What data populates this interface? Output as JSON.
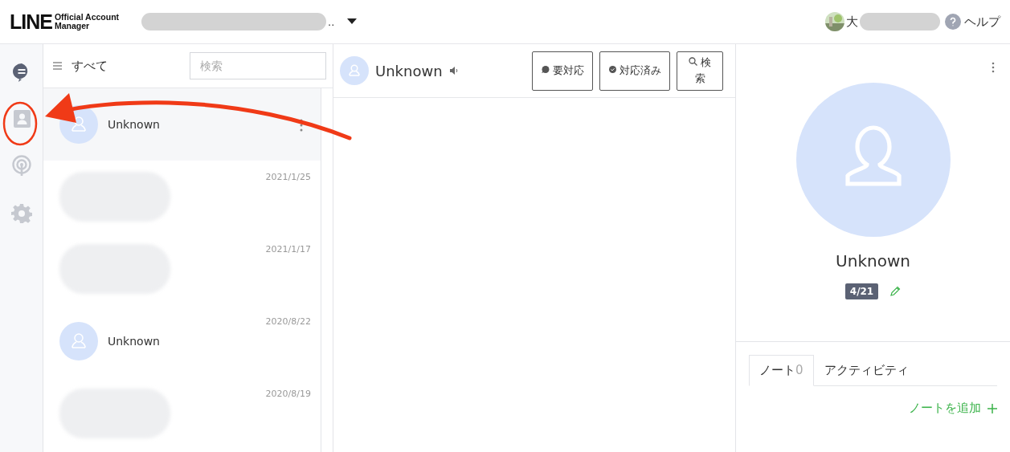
{
  "header": {
    "logo_word": "LINE",
    "logo_sub": [
      "Official Account",
      "Manager"
    ],
    "account_name": "..",
    "user_name": "大",
    "help": "ヘルプ"
  },
  "nav": [
    {
      "kind": "chat",
      "selected": true
    },
    {
      "kind": "contacts",
      "selected": false
    },
    {
      "kind": "broadcast",
      "selected": false
    },
    {
      "kind": "settings",
      "selected": false
    }
  ],
  "list": {
    "filter": "すべて",
    "search": {
      "placeholder": "検索"
    },
    "items": [
      {
        "kind": "contact",
        "name": "Unknown",
        "selected": true
      },
      {
        "kind": "blurred",
        "date": "2021/1/25",
        "selected": false
      },
      {
        "kind": "blurred",
        "date": "2021/1/17",
        "selected": false
      },
      {
        "kind": "contact",
        "name": "Unknown",
        "date": "2020/8/22",
        "selected": false
      },
      {
        "kind": "blurred",
        "date": "2020/8/19",
        "selected": false
      }
    ]
  },
  "chat": {
    "name": "Unknown",
    "buttons": [
      {
        "kind": "todo",
        "label": "要対応"
      },
      {
        "kind": "done",
        "label": "対応済み"
      },
      {
        "kind": "search",
        "label": "検索"
      }
    ]
  },
  "profile": {
    "name": "Unknown",
    "tag": "4/21",
    "tabs": [
      {
        "label": "ノート",
        "count": "0",
        "selected": true
      },
      {
        "label": "アクティビティ",
        "selected": false
      }
    ],
    "add_note": "ノートを追加"
  }
}
